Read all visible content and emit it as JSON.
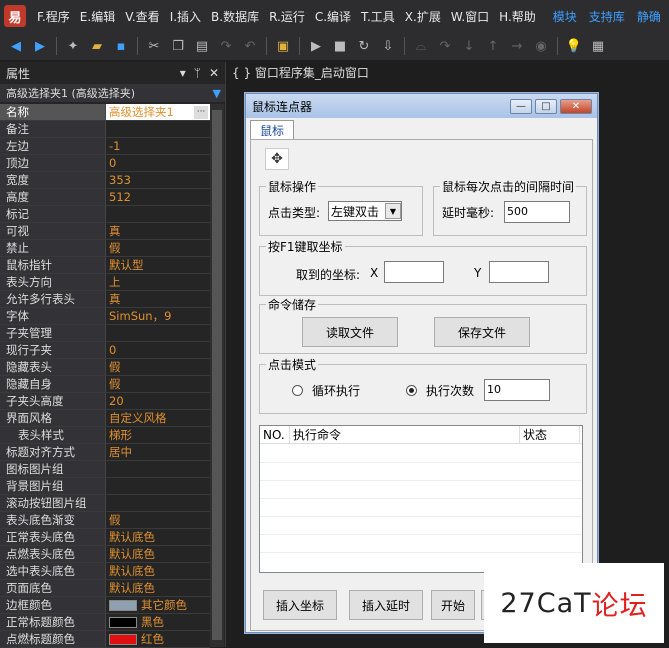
{
  "menu": [
    "F.程序",
    "E.编辑",
    "V.查看",
    "I.插入",
    "B.数据库",
    "R.运行",
    "C.编译",
    "T.工具",
    "X.扩展",
    "W.窗口",
    "H.帮助"
  ],
  "menu_right": [
    "模块",
    "支持库",
    "静确"
  ],
  "properties": {
    "title": "属性",
    "object_combo": "高级选择夹1 (高级选择夹)",
    "rows": [
      {
        "k": "名称",
        "v": "高级选择夹1",
        "sel": true
      },
      {
        "k": "备注",
        "v": ""
      },
      {
        "k": "左边",
        "v": "-1"
      },
      {
        "k": "顶边",
        "v": "0"
      },
      {
        "k": "宽度",
        "v": "353"
      },
      {
        "k": "高度",
        "v": "512"
      },
      {
        "k": "标记",
        "v": ""
      },
      {
        "k": "可视",
        "v": "真"
      },
      {
        "k": "禁止",
        "v": "假"
      },
      {
        "k": "鼠标指针",
        "v": "默认型"
      },
      {
        "k": "表头方向",
        "v": "上"
      },
      {
        "k": "允许多行表头",
        "v": "真"
      },
      {
        "k": "字体",
        "v": "SimSun，9"
      },
      {
        "k": "子夹管理",
        "v": ""
      },
      {
        "k": "现行子夹",
        "v": "0"
      },
      {
        "k": "隐藏表头",
        "v": "假"
      },
      {
        "k": "隐藏自身",
        "v": "假"
      },
      {
        "k": "子夹头高度",
        "v": "20"
      },
      {
        "k": "界面风格",
        "v": "自定义风格"
      },
      {
        "k": "表头样式",
        "v": "梯形",
        "indent": true
      },
      {
        "k": "标题对齐方式",
        "v": "居中"
      },
      {
        "k": "图标图片组",
        "v": ""
      },
      {
        "k": "背景图片组",
        "v": ""
      },
      {
        "k": "滚动按钮图片组",
        "v": ""
      },
      {
        "k": "表头底色渐变",
        "v": "假"
      },
      {
        "k": "正常表头底色",
        "v": "默认底色"
      },
      {
        "k": "点燃表头底色",
        "v": "默认底色"
      },
      {
        "k": "选中表头底色",
        "v": "默认底色"
      },
      {
        "k": "页面底色",
        "v": "默认底色"
      },
      {
        "k": "边框颜色",
        "v": "其它颜色",
        "swatch": "#8fa0b0"
      },
      {
        "k": "正常标题颜色",
        "v": "黑色",
        "swatch": "#000000"
      },
      {
        "k": "点燃标题颜色",
        "v": "红色",
        "swatch": "#e01010"
      }
    ]
  },
  "doc_tab": "{ } 窗口程序集_启动窗口",
  "window": {
    "title": "鼠标连点器",
    "tab": "鼠标",
    "group_mouse": "鼠标操作",
    "click_type_label": "点击类型:",
    "click_type_value": "左键双击",
    "group_interval": "鼠标每次点击的间隔时间",
    "delay_label": "延时毫秒:",
    "delay_value": "500",
    "group_coord": "按F1键取坐标",
    "coord_label": "取到的坐标:",
    "x_label": "X",
    "y_label": "Y",
    "x_value": "",
    "y_value": "",
    "group_store": "命令储存",
    "read_file": "读取文件",
    "save_file": "保存文件",
    "group_mode": "点击模式",
    "loop_label": "循环执行",
    "count_label": "执行次数",
    "count_value": "10",
    "col_no": "NO.",
    "col_cmd": "执行命令",
    "col_status": "状态",
    "btn_insert_coord": "插入坐标",
    "btn_insert_delay": "插入延时",
    "btn_start": "开始",
    "btn_partial": "F"
  },
  "watermark": {
    "prefix": "27CaT",
    "suffix": "论坛"
  }
}
